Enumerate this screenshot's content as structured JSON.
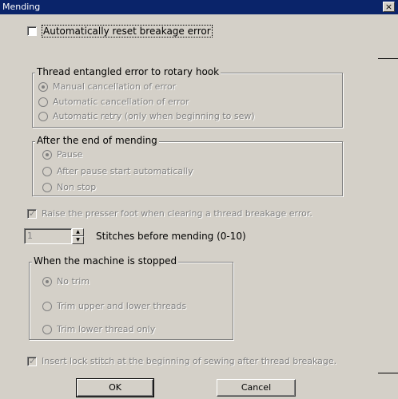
{
  "window": {
    "title": "Mending",
    "close_glyph": "×"
  },
  "auto_reset": {
    "label": "Automatically reset breakage error",
    "checked": false
  },
  "thread_group": {
    "legend": "Thread entangled error to rotary hook",
    "options": [
      {
        "label": "Manual cancellation of error",
        "selected": true
      },
      {
        "label": "Automatic cancellation of error",
        "selected": false
      },
      {
        "label": "Automatic retry (only when beginning to sew)",
        "selected": false
      }
    ]
  },
  "after_group": {
    "legend": "After the end of mending",
    "options": [
      {
        "label": "Pause",
        "selected": true
      },
      {
        "label": "After pause start automatically",
        "selected": false
      },
      {
        "label": "Non stop",
        "selected": false
      }
    ]
  },
  "raise_presser": {
    "label": "Raise the presser foot when clearing a thread breakage error.",
    "checked": true
  },
  "stitches": {
    "value": "1",
    "label": "Stitches before mending  (0-10)"
  },
  "stopped_group": {
    "legend": "When the machine is stopped",
    "options": [
      {
        "label": "No trim",
        "selected": true
      },
      {
        "label": "Trim upper and lower threads",
        "selected": false
      },
      {
        "label": "Trim lower thread only",
        "selected": false
      }
    ]
  },
  "lock_stitch": {
    "label": "Insert lock stitch at the beginning of sewing after thread breakage.",
    "checked": true
  },
  "buttons": {
    "ok": "OK",
    "cancel": "Cancel"
  }
}
